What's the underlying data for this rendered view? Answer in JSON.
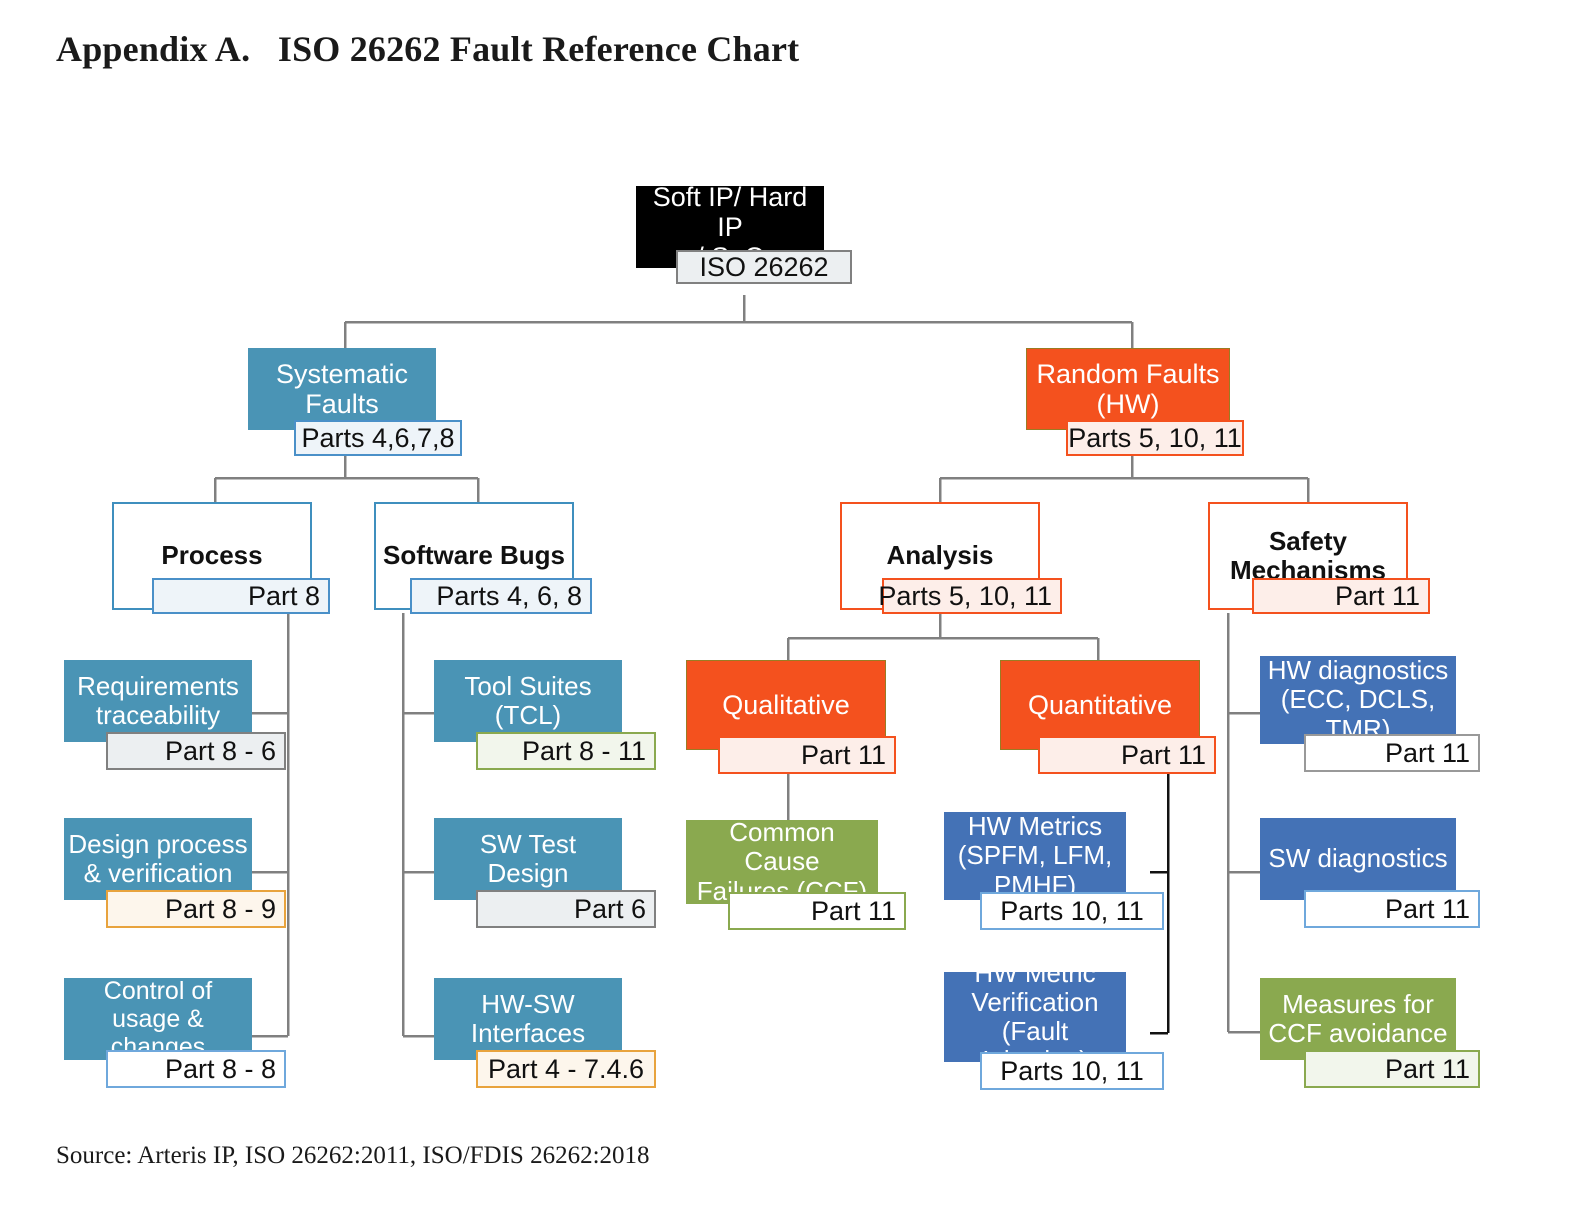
{
  "page": {
    "title": "Appendix A.   ISO 26262 Fault Reference Chart",
    "source": "Source: Arteris IP, ISO 26262:2011, ISO/FDIS 26262:2018"
  },
  "colors": {
    "black": "#000000",
    "steel_blue": "#4a94b5",
    "orange_red": "#f4511e",
    "medium_blue": "#4472b6",
    "olive_green": "#8aa94f",
    "connector_gray": "#808080",
    "connector_black": "#000000",
    "border_blue": "#3f8fbe",
    "border_amber": "#e8a33d"
  },
  "chart_data": {
    "type": "diagram",
    "title": "ISO 26262 Fault Reference Chart",
    "subtype": "hierarchical-tree",
    "levels": 4,
    "root": "Soft IP/ Hard IP / SoC"
  },
  "nodes": {
    "root": {
      "label": "Soft IP/ Hard IP\n/ SoC",
      "tag": "ISO 26262"
    },
    "systematic": {
      "label": "Systematic\nFaults",
      "tag": "Parts 4,6,7,8"
    },
    "random": {
      "label": "Random Faults\n(HW)",
      "tag": "Parts 5, 10, 11"
    },
    "process": {
      "label": "Process",
      "tag": "Part 8"
    },
    "software_bugs": {
      "label": "Software Bugs",
      "tag": "Parts 4, 6, 8"
    },
    "analysis": {
      "label": "Analysis",
      "tag": "Parts 5, 10, 11"
    },
    "safety_mechanisms": {
      "label": "Safety\nMechanisms",
      "tag": "Part 11"
    },
    "requirements_traceability": {
      "label": "Requirements\ntraceability",
      "tag": "Part 8 - 6"
    },
    "design_process": {
      "label": "Design process\n& verification",
      "tag": "Part 8 - 9"
    },
    "control_usage": {
      "label": "Control of usage &\nchanges",
      "tag": "Part 8 - 8"
    },
    "tool_suites": {
      "label": "Tool Suites\n(TCL)",
      "tag": "Part 8 - 11"
    },
    "sw_test_design": {
      "label": "SW Test Design",
      "tag": "Part 6"
    },
    "hw_sw_interfaces": {
      "label": "HW-SW\nInterfaces",
      "tag": "Part 4 - 7.4.6"
    },
    "qualitative": {
      "label": "Qualitative",
      "tag": "Part 11"
    },
    "quantitative": {
      "label": "Quantitative",
      "tag": "Part 11"
    },
    "common_cause_failures": {
      "label": "Common Cause\nFailures (CCF)",
      "tag": "Part 11"
    },
    "hw_metrics": {
      "label": "HW Metrics\n(SPFM, LFM,\nPMHF)",
      "tag": "Parts 10, 11"
    },
    "hw_metric_verification": {
      "label": "HW Metric\nVerification\n(Fault Injection)",
      "tag": "Parts 10, 11"
    },
    "hw_diagnostics": {
      "label": "HW diagnostics\n(ECC, DCLS,\nTMR)",
      "tag": "Part 11"
    },
    "sw_diagnostics": {
      "label": "SW diagnostics",
      "tag": "Part 11"
    },
    "measures_ccf_avoidance": {
      "label": "Measures for\nCCF avoidance",
      "tag": "Part 11"
    }
  }
}
